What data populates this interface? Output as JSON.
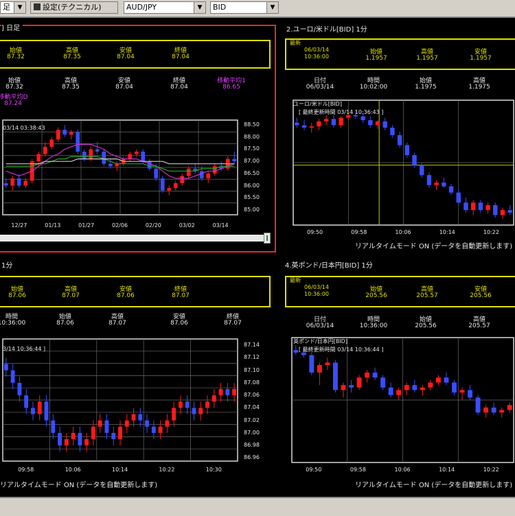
{
  "toolbar": {
    "period_select": "足",
    "settings_button": "設定(テクニカル)",
    "pair_select": "AUD/JPY",
    "price_select": "BID"
  },
  "panels": {
    "p1": {
      "title": "] 日足",
      "quote_labels": [
        "始値",
        "高値",
        "安値",
        "終値"
      ],
      "quote_values": [
        "87.32",
        "87.35",
        "87.04",
        "87.04"
      ],
      "row_labels": [
        "始値",
        "高値",
        "安値",
        "終値"
      ],
      "row_values": [
        "87.32",
        "87.35",
        "87.04",
        "87.04"
      ],
      "ma_label": "移動平均1",
      "ma_value": "86.65",
      "ma2_label": "移動平均D",
      "ma2_value": "87.24",
      "chart_info": "03/14 03:38:43"
    },
    "p2": {
      "title": "2.ユーロ/米ドル[BID] 1分",
      "quote_box_label": "最新",
      "quote_labels": [
        "",
        "始値",
        "高値",
        "安値"
      ],
      "quote_values": [
        "06/03/14 10:36:00",
        "1.1957",
        "1.1957",
        "1.1957"
      ],
      "row_labels": [
        "日付",
        "時間",
        "始値",
        "高値"
      ],
      "row_values": [
        "06/03/14",
        "10:02:00",
        "1.1975",
        "1.1975"
      ],
      "chart_title": "ユーロ/米ドル[BID]",
      "chart_info": "[ 最終更新時間 03/14 10:36:43 ]",
      "realtime": "リアルタイムモード ON (データを自動更新します)"
    },
    "p3": {
      "title": "1分",
      "quote_labels": [
        "始値",
        "高値",
        "安値",
        "終値"
      ],
      "quote_values": [
        "87.06",
        "87.07",
        "87.06",
        "87.07"
      ],
      "row_labels": [
        "時間",
        "始値",
        "高値",
        "安値",
        "終値"
      ],
      "row_values": [
        "10:36:00",
        "87.06",
        "87.07",
        "87.06",
        "87.07"
      ],
      "chart_info": "3/14 10:36:44 ]",
      "realtime": "リアルタイムモード ON (データを自動更新します)"
    },
    "p4": {
      "title": "4.英ポンド/日本円[BID] 1分",
      "quote_box_label": "最新",
      "quote_labels": [
        "",
        "始値",
        "高値",
        "安値"
      ],
      "quote_values": [
        "06/03/14 10:36:00",
        "205.56",
        "205.57",
        "205.56"
      ],
      "row_labels": [
        "日付",
        "時間",
        "始値",
        "高値"
      ],
      "row_values": [
        "06/03/14",
        "10:36:00",
        "205.56",
        "205.57"
      ],
      "chart_title": "英ポンド/日本円[BID]",
      "chart_info": "[ 最終更新時間 03/14 10:36:44 ]",
      "realtime": "リアルタイムモード ON (データを自動更新します)"
    }
  },
  "chart_data": [
    {
      "type": "candlestick",
      "panel": "p1",
      "y_ticks": [
        "88.50",
        "88.00",
        "87.50",
        "87.00",
        "86.50",
        "86.00",
        "85.50",
        "85.00"
      ],
      "x_ticks": [
        "12/27",
        "01/13",
        "01/27",
        "02/06",
        "02/20",
        "03/02",
        "03/14"
      ],
      "ylim": [
        84.8,
        88.7
      ],
      "candles": [
        [
          86.1,
          86.3,
          85.9,
          86.0
        ],
        [
          86.0,
          86.4,
          85.8,
          86.3
        ],
        [
          86.3,
          86.5,
          85.9,
          86.0
        ],
        [
          86.0,
          86.3,
          85.9,
          86.2
        ],
        [
          86.2,
          87.1,
          86.1,
          87.0
        ],
        [
          87.0,
          87.4,
          86.8,
          87.3
        ],
        [
          87.3,
          87.8,
          87.2,
          87.6
        ],
        [
          87.6,
          88.0,
          87.5,
          87.9
        ],
        [
          87.9,
          88.4,
          87.8,
          88.3
        ],
        [
          88.3,
          88.5,
          88.0,
          88.1
        ],
        [
          88.1,
          88.3,
          87.9,
          88.2
        ],
        [
          88.2,
          88.3,
          87.3,
          87.4
        ],
        [
          87.4,
          87.5,
          87.0,
          87.1
        ],
        [
          87.1,
          87.6,
          87.0,
          87.5
        ],
        [
          87.5,
          87.8,
          87.3,
          87.4
        ],
        [
          87.4,
          87.5,
          86.8,
          86.9
        ],
        [
          86.9,
          87.1,
          86.7,
          86.8
        ],
        [
          86.8,
          87.0,
          86.6,
          86.9
        ],
        [
          86.9,
          87.2,
          86.8,
          87.1
        ],
        [
          87.1,
          87.4,
          87.0,
          87.3
        ],
        [
          87.3,
          87.5,
          87.2,
          87.4
        ],
        [
          87.4,
          87.5,
          86.9,
          87.0
        ],
        [
          87.0,
          87.1,
          86.6,
          86.7
        ],
        [
          86.7,
          86.9,
          86.2,
          86.3
        ],
        [
          86.3,
          86.4,
          85.7,
          85.8
        ],
        [
          85.8,
          86.0,
          85.6,
          85.9
        ],
        [
          85.9,
          86.2,
          85.8,
          86.1
        ],
        [
          86.1,
          86.5,
          86.0,
          86.4
        ],
        [
          86.4,
          86.8,
          86.3,
          86.7
        ],
        [
          86.7,
          86.9,
          86.5,
          86.6
        ],
        [
          86.6,
          86.8,
          86.2,
          86.3
        ],
        [
          86.3,
          86.6,
          86.1,
          86.5
        ],
        [
          86.5,
          86.9,
          86.4,
          86.8
        ],
        [
          86.8,
          87.0,
          86.6,
          86.7
        ],
        [
          86.7,
          87.2,
          86.6,
          87.1
        ],
        [
          87.1,
          87.4,
          86.9,
          87.0
        ]
      ],
      "ma1": [
        86.6,
        86.5,
        86.4,
        86.5,
        86.6,
        86.8,
        87.0,
        87.2,
        87.3,
        87.5,
        87.6,
        87.7,
        87.7,
        87.7,
        87.6,
        87.5,
        87.3,
        87.2,
        87.1,
        87.1,
        87.1,
        87.0,
        86.9,
        86.8,
        86.6,
        86.4,
        86.3,
        86.3,
        86.3,
        86.4,
        86.5,
        86.6,
        86.6,
        86.7,
        86.8,
        86.9
      ],
      "ma2": [
        86.8,
        86.8,
        86.8,
        86.8,
        86.8,
        86.9,
        86.9,
        87.0,
        87.1,
        87.1,
        87.2,
        87.2,
        87.2,
        87.2,
        87.2,
        87.1,
        87.0,
        86.9,
        86.9,
        86.9,
        86.9,
        86.9,
        86.8,
        86.8,
        86.7,
        86.6,
        86.6,
        86.6,
        86.6,
        86.6,
        86.7,
        86.7,
        86.7,
        86.8,
        86.8,
        86.8
      ],
      "ma3": [
        86.9,
        86.9,
        86.9,
        86.9,
        86.9,
        86.9,
        87.0,
        87.0,
        87.0,
        87.0,
        87.0,
        87.1,
        87.1,
        87.1,
        87.1,
        87.1,
        87.1,
        87.1,
        87.0,
        87.0,
        87.0,
        87.0,
        87.0,
        87.0,
        87.0,
        86.9,
        86.9,
        86.9,
        86.9,
        86.9,
        86.9,
        86.9,
        86.9,
        86.9,
        86.9,
        86.9
      ]
    },
    {
      "type": "candlestick",
      "panel": "p2",
      "x_ticks": [
        "09:50",
        "09:58",
        "10:06",
        "10:14",
        "10:22"
      ],
      "ylim": [
        0,
        1
      ],
      "candles": [
        [
          0.82,
          0.86,
          0.78,
          0.8
        ],
        [
          0.8,
          0.84,
          0.76,
          0.78
        ],
        [
          0.78,
          0.82,
          0.74,
          0.79
        ],
        [
          0.79,
          0.85,
          0.76,
          0.83
        ],
        [
          0.83,
          0.88,
          0.8,
          0.85
        ],
        [
          0.85,
          0.88,
          0.78,
          0.8
        ],
        [
          0.8,
          0.87,
          0.78,
          0.86
        ],
        [
          0.86,
          0.9,
          0.84,
          0.88
        ],
        [
          0.88,
          0.92,
          0.85,
          0.87
        ],
        [
          0.87,
          0.9,
          0.82,
          0.84
        ],
        [
          0.84,
          0.87,
          0.78,
          0.8
        ],
        [
          0.8,
          0.84,
          0.77,
          0.83
        ],
        [
          0.83,
          0.86,
          0.76,
          0.78
        ],
        [
          0.78,
          0.8,
          0.7,
          0.72
        ],
        [
          0.72,
          0.75,
          0.62,
          0.64
        ],
        [
          0.64,
          0.66,
          0.54,
          0.56
        ],
        [
          0.56,
          0.58,
          0.46,
          0.48
        ],
        [
          0.48,
          0.5,
          0.38,
          0.4
        ],
        [
          0.4,
          0.42,
          0.3,
          0.32
        ],
        [
          0.32,
          0.36,
          0.28,
          0.34
        ],
        [
          0.34,
          0.38,
          0.3,
          0.31
        ],
        [
          0.31,
          0.33,
          0.24,
          0.26
        ],
        [
          0.26,
          0.28,
          0.16,
          0.18
        ],
        [
          0.18,
          0.22,
          0.1,
          0.12
        ],
        [
          0.12,
          0.2,
          0.08,
          0.18
        ],
        [
          0.18,
          0.2,
          0.1,
          0.12
        ],
        [
          0.12,
          0.18,
          0.09,
          0.16
        ],
        [
          0.16,
          0.18,
          0.06,
          0.08
        ],
        [
          0.08,
          0.14,
          0.05,
          0.12
        ],
        [
          0.12,
          0.16,
          0.08,
          0.1
        ]
      ]
    },
    {
      "type": "candlestick",
      "panel": "p3",
      "y_ticks": [
        "87.14",
        "87.12",
        "87.10",
        "87.08",
        "87.06",
        "87.04",
        "87.02",
        "87.00",
        "86.98",
        "86.96"
      ],
      "x_ticks": [
        "09:58",
        "10:06",
        "10:14",
        "10:22",
        "10:30"
      ],
      "ylim": [
        86.955,
        87.15
      ],
      "candles": [
        [
          87.11,
          87.12,
          87.09,
          87.1
        ],
        [
          87.1,
          87.11,
          87.07,
          87.08
        ],
        [
          87.08,
          87.09,
          87.05,
          87.06
        ],
        [
          87.06,
          87.07,
          87.03,
          87.04
        ],
        [
          87.04,
          87.05,
          87.02,
          87.03
        ],
        [
          87.03,
          87.06,
          87.02,
          87.05
        ],
        [
          87.05,
          87.06,
          87.01,
          87.02
        ],
        [
          87.02,
          87.03,
          86.99,
          87.0
        ],
        [
          87.0,
          87.01,
          86.97,
          86.98
        ],
        [
          86.98,
          87.0,
          86.97,
          86.99
        ],
        [
          86.99,
          87.01,
          86.98,
          87.0
        ],
        [
          87.0,
          87.01,
          86.97,
          86.98
        ],
        [
          86.98,
          87.0,
          86.97,
          86.99
        ],
        [
          86.99,
          87.02,
          86.98,
          87.01
        ],
        [
          87.01,
          87.03,
          87.0,
          87.02
        ],
        [
          87.02,
          87.03,
          86.99,
          87.0
        ],
        [
          87.0,
          87.01,
          86.98,
          86.99
        ],
        [
          86.99,
          87.02,
          86.98,
          87.01
        ],
        [
          87.01,
          87.03,
          87.0,
          87.02
        ],
        [
          87.02,
          87.04,
          87.01,
          87.03
        ],
        [
          87.03,
          87.04,
          87.01,
          87.02
        ],
        [
          87.02,
          87.03,
          87.0,
          87.01
        ],
        [
          87.01,
          87.02,
          86.99,
          87.0
        ],
        [
          87.0,
          87.02,
          86.99,
          87.01
        ],
        [
          87.01,
          87.03,
          87.0,
          87.02
        ],
        [
          87.02,
          87.05,
          87.01,
          87.04
        ],
        [
          87.04,
          87.06,
          87.03,
          87.05
        ],
        [
          87.05,
          87.06,
          87.03,
          87.04
        ],
        [
          87.04,
          87.05,
          87.02,
          87.03
        ],
        [
          87.03,
          87.05,
          87.02,
          87.04
        ],
        [
          87.04,
          87.06,
          87.03,
          87.05
        ],
        [
          87.05,
          87.07,
          87.04,
          87.06
        ],
        [
          87.06,
          87.08,
          87.05,
          87.07
        ],
        [
          87.07,
          87.08,
          87.05,
          87.06
        ],
        [
          87.06,
          87.08,
          87.05,
          87.07
        ]
      ]
    },
    {
      "type": "candlestick",
      "panel": "p4",
      "x_ticks": [
        "09:50",
        "09:58",
        "10:06",
        "10:14",
        "10:22"
      ],
      "ylim": [
        0,
        1
      ],
      "candles": [
        [
          0.9,
          0.94,
          0.86,
          0.88
        ],
        [
          0.88,
          0.92,
          0.84,
          0.86
        ],
        [
          0.86,
          0.88,
          0.7,
          0.72
        ],
        [
          0.72,
          0.8,
          0.62,
          0.78
        ],
        [
          0.78,
          0.84,
          0.74,
          0.8
        ],
        [
          0.8,
          0.82,
          0.56,
          0.58
        ],
        [
          0.58,
          0.64,
          0.52,
          0.62
        ],
        [
          0.62,
          0.66,
          0.56,
          0.6
        ],
        [
          0.6,
          0.7,
          0.58,
          0.68
        ],
        [
          0.68,
          0.74,
          0.64,
          0.72
        ],
        [
          0.72,
          0.76,
          0.66,
          0.68
        ],
        [
          0.68,
          0.7,
          0.58,
          0.6
        ],
        [
          0.6,
          0.64,
          0.52,
          0.54
        ],
        [
          0.54,
          0.6,
          0.5,
          0.58
        ],
        [
          0.58,
          0.64,
          0.54,
          0.62
        ],
        [
          0.62,
          0.66,
          0.56,
          0.58
        ],
        [
          0.58,
          0.62,
          0.54,
          0.6
        ],
        [
          0.6,
          0.66,
          0.58,
          0.64
        ],
        [
          0.64,
          0.7,
          0.62,
          0.68
        ],
        [
          0.68,
          0.72,
          0.62,
          0.64
        ],
        [
          0.64,
          0.66,
          0.54,
          0.56
        ],
        [
          0.56,
          0.6,
          0.5,
          0.58
        ],
        [
          0.58,
          0.62,
          0.5,
          0.52
        ],
        [
          0.52,
          0.54,
          0.38,
          0.4
        ],
        [
          0.4,
          0.46,
          0.36,
          0.44
        ],
        [
          0.44,
          0.48,
          0.38,
          0.4
        ],
        [
          0.4,
          0.44,
          0.36,
          0.42
        ],
        [
          0.42,
          0.48,
          0.4,
          0.46
        ]
      ]
    }
  ],
  "colors": {
    "bull": "#ff1a1a",
    "bear": "#3a4dff",
    "panel_border_active": "#e03020",
    "quote_box": "#e0e000",
    "grid": "#6a6a6a",
    "crosshair": "#c8c800",
    "ma1": "#cc33cc",
    "ma2": "#22aa22",
    "ma3": "#cccccc"
  }
}
